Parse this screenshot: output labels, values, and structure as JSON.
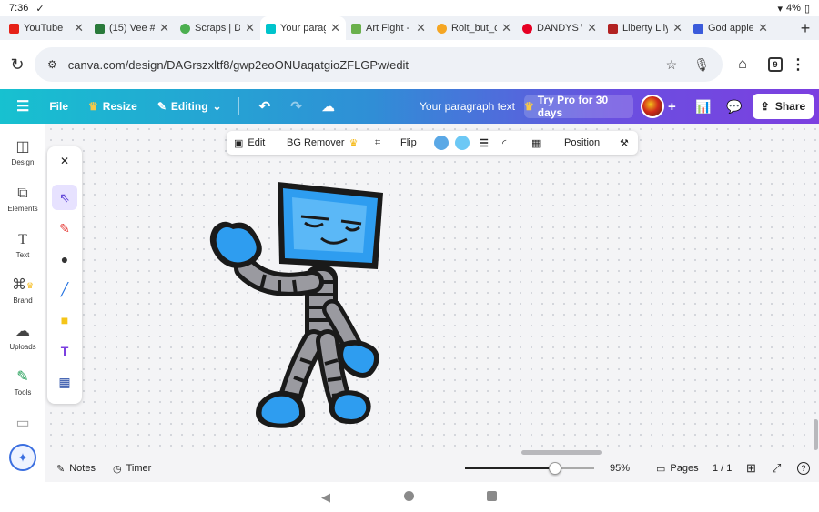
{
  "status": {
    "time": "7:36",
    "battery": "4%"
  },
  "tabs": [
    {
      "label": "YouTube",
      "favicon_color": "#e62117"
    },
    {
      "label": "(15) Vee #",
      "favicon_color": "#2a7a3b"
    },
    {
      "label": "Scraps | Da",
      "favicon_color": "#4caf50"
    },
    {
      "label": "Your parag",
      "favicon_color": "#00c4cc",
      "active": true
    },
    {
      "label": "Art Fight - ",
      "favicon_color": "#6ab04c"
    },
    {
      "label": "Rolt_but_cc",
      "favicon_color": "#f5a623"
    },
    {
      "label": "DANDYS W",
      "favicon_color": "#e60023"
    },
    {
      "label": "Liberty Lily",
      "favicon_color": "#b22222"
    },
    {
      "label": "God apple",
      "favicon_color": "#3b5bdb"
    }
  ],
  "address": {
    "url": "canva.com/design/DAGrszxltf8/gwp2eoONUaqatgioZFLGPw/edit",
    "tab_count": "9"
  },
  "header": {
    "file": "File",
    "resize": "Resize",
    "editing": "Editing",
    "title": "Your paragraph text",
    "try_pro": "Try Pro for 30 days",
    "share": "Share"
  },
  "rail": [
    {
      "label": "Design",
      "icon": "design-icon"
    },
    {
      "label": "Elements",
      "icon": "elements-icon"
    },
    {
      "label": "Text",
      "icon": "text-icon"
    },
    {
      "label": "Brand",
      "icon": "brand-icon"
    },
    {
      "label": "Uploads",
      "icon": "uploads-icon"
    },
    {
      "label": "Tools",
      "icon": "tools-icon"
    }
  ],
  "context_toolbar": {
    "edit": "Edit",
    "bg_remover": "BG Remover",
    "flip": "Flip",
    "position": "Position",
    "swatch_1": "#5aa8e6",
    "swatch_2": "#6cc8f5"
  },
  "bottom": {
    "notes": "Notes",
    "timer": "Timer",
    "zoom": "95%",
    "pages": "Pages",
    "page_indicator": "1 / 1",
    "zoom_fraction": 0.95
  },
  "colors": {
    "accent": "#7c3fe0",
    "character_blue": "#2e9df0",
    "character_gray": "#9a9aa0"
  }
}
